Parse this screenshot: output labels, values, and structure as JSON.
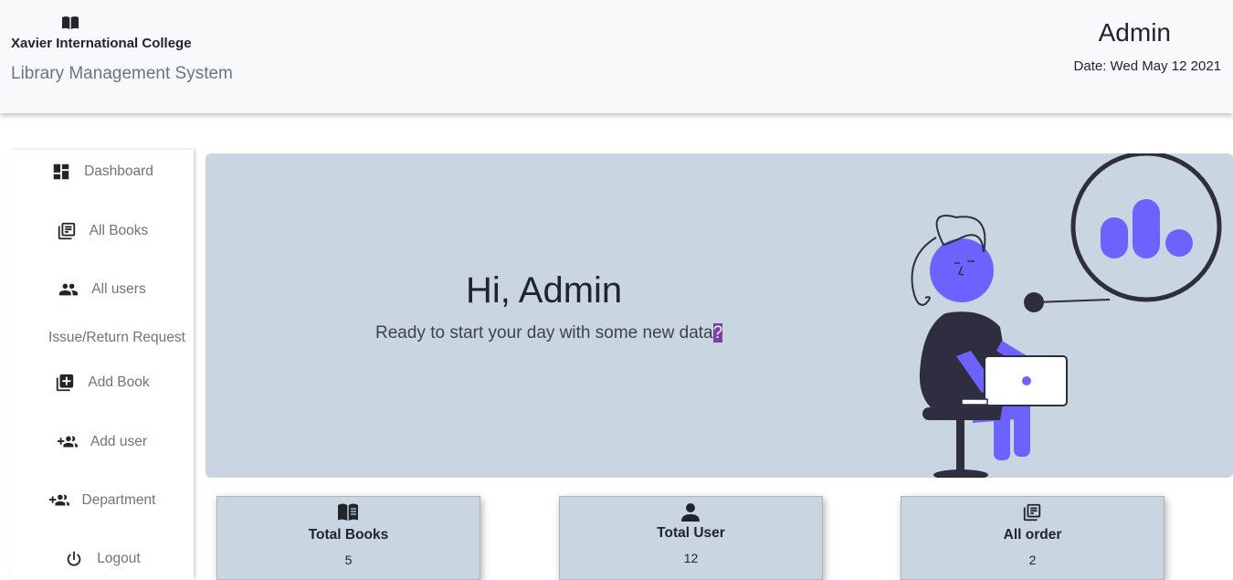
{
  "header": {
    "college": "Xavier International College",
    "system": "Library Management System",
    "user": "Admin",
    "date": "Date: Wed May 12 2021"
  },
  "sidebar": {
    "items": [
      {
        "label": "Dashboard",
        "icon": "dashboard-icon"
      },
      {
        "label": "All Books",
        "icon": "library-books-icon"
      },
      {
        "label": "All users",
        "icon": "people-icon"
      },
      {
        "label": "Issue/Return Request",
        "icon": ""
      },
      {
        "label": "Add Book",
        "icon": "library-add-icon"
      },
      {
        "label": "Add user",
        "icon": "group-add-icon"
      },
      {
        "label": "Department",
        "icon": "group-add-icon"
      },
      {
        "label": "Logout",
        "icon": "power-icon"
      }
    ]
  },
  "hero": {
    "title": "Hi, Admin",
    "subtitle": "Ready to start your day with some new data",
    "subtitle_selected": "?"
  },
  "stats": [
    {
      "title": "Total Books",
      "value": "5",
      "icon": "open-book-icon"
    },
    {
      "title": "Total User",
      "value": "12",
      "icon": "person-icon"
    },
    {
      "title": "All order",
      "value": "2",
      "icon": "library-books-icon"
    }
  ],
  "colors": {
    "header_bg": "#f8f9fa",
    "hero_bg": "#c9d5e0",
    "accent": "#6c63ff",
    "dark": "#2f2e41",
    "selection": "#7e3fae"
  }
}
